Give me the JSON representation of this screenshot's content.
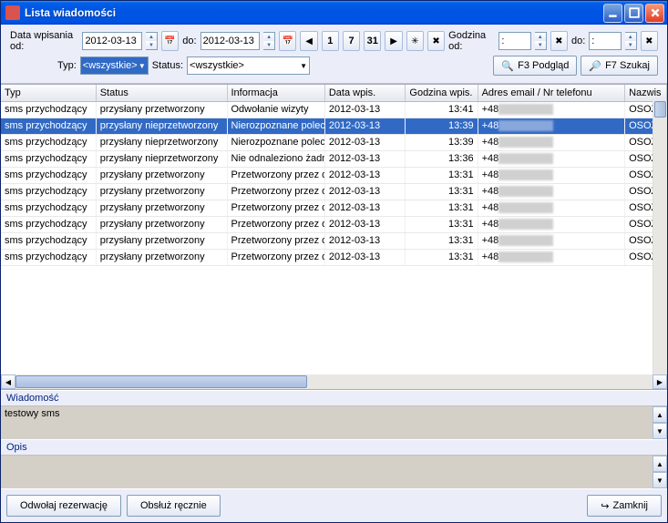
{
  "window": {
    "title": "Lista wiadomości"
  },
  "toolbar": {
    "date_from_label": "Data wpisania od:",
    "date_from": "2012-03-13",
    "date_to_label": "do:",
    "date_to": "2012-03-13",
    "time_from_label": "Godzina od:",
    "time_from": ":",
    "time_to_label": "do:",
    "time_to": ":",
    "type_label": "Typ:",
    "type_value": "<wszystkie>",
    "status_label": "Status:",
    "status_value": "<wszystkie>",
    "preview_btn": "F3 Podgląd",
    "search_btn": "F7 Szukaj"
  },
  "grid": {
    "headers": {
      "typ": "Typ",
      "status": "Status",
      "info": "Informacja",
      "data": "Data wpis.",
      "godz": "Godzina wpis.",
      "adres": "Adres email / Nr telefonu",
      "nazw": "Nazwis"
    },
    "rows": [
      {
        "typ": "sms przychodzący",
        "status": "przysłany przetworzony",
        "info": "Odwołanie wizyty",
        "data": "2012-03-13",
        "godz": "13:41",
        "adres": "+48",
        "nazw": "OSOZ",
        "selected": false
      },
      {
        "typ": "sms przychodzący",
        "status": "przysłany nieprzetworzony",
        "info": "Nierozpoznane polec",
        "data": "2012-03-13",
        "godz": "13:39",
        "adres": "+48",
        "nazw": "OSOZ",
        "selected": true
      },
      {
        "typ": "sms przychodzący",
        "status": "przysłany nieprzetworzony",
        "info": "Nierozpoznane polec",
        "data": "2012-03-13",
        "godz": "13:39",
        "adres": "+48",
        "nazw": "OSOZ",
        "selected": false
      },
      {
        "typ": "sms przychodzący",
        "status": "przysłany nieprzetworzony",
        "info": "Nie odnaleziono żadn",
        "data": "2012-03-13",
        "godz": "13:36",
        "adres": "+48",
        "nazw": "OSOZ",
        "selected": false
      },
      {
        "typ": "sms przychodzący",
        "status": "przysłany przetworzony",
        "info": "Przetworzony przez o",
        "data": "2012-03-13",
        "godz": "13:31",
        "adres": "+48",
        "nazw": "OSOZ",
        "selected": false
      },
      {
        "typ": "sms przychodzący",
        "status": "przysłany przetworzony",
        "info": "Przetworzony przez o",
        "data": "2012-03-13",
        "godz": "13:31",
        "adres": "+48",
        "nazw": "OSOZ",
        "selected": false
      },
      {
        "typ": "sms przychodzący",
        "status": "przysłany przetworzony",
        "info": "Przetworzony przez o",
        "data": "2012-03-13",
        "godz": "13:31",
        "adres": "+48",
        "nazw": "OSOZ",
        "selected": false
      },
      {
        "typ": "sms przychodzący",
        "status": "przysłany przetworzony",
        "info": "Przetworzony przez o",
        "data": "2012-03-13",
        "godz": "13:31",
        "adres": "+48",
        "nazw": "OSOZ",
        "selected": false
      },
      {
        "typ": "sms przychodzący",
        "status": "przysłany przetworzony",
        "info": "Przetworzony przez o",
        "data": "2012-03-13",
        "godz": "13:31",
        "adres": "+48",
        "nazw": "OSOZ",
        "selected": false
      },
      {
        "typ": "sms przychodzący",
        "status": "przysłany przetworzony",
        "info": "Przetworzony przez o",
        "data": "2012-03-13",
        "godz": "13:31",
        "adres": "+48",
        "nazw": "OSOZ",
        "selected": false
      }
    ]
  },
  "sections": {
    "wiadomosc_label": "Wiadomość",
    "wiadomosc_text": "testowy sms",
    "opis_label": "Opis",
    "opis_text": ""
  },
  "bottom": {
    "cancel_reservation": "Odwołaj rezerwację",
    "handle_manual": "Obsłuż ręcznie",
    "close": "Zamknij"
  }
}
